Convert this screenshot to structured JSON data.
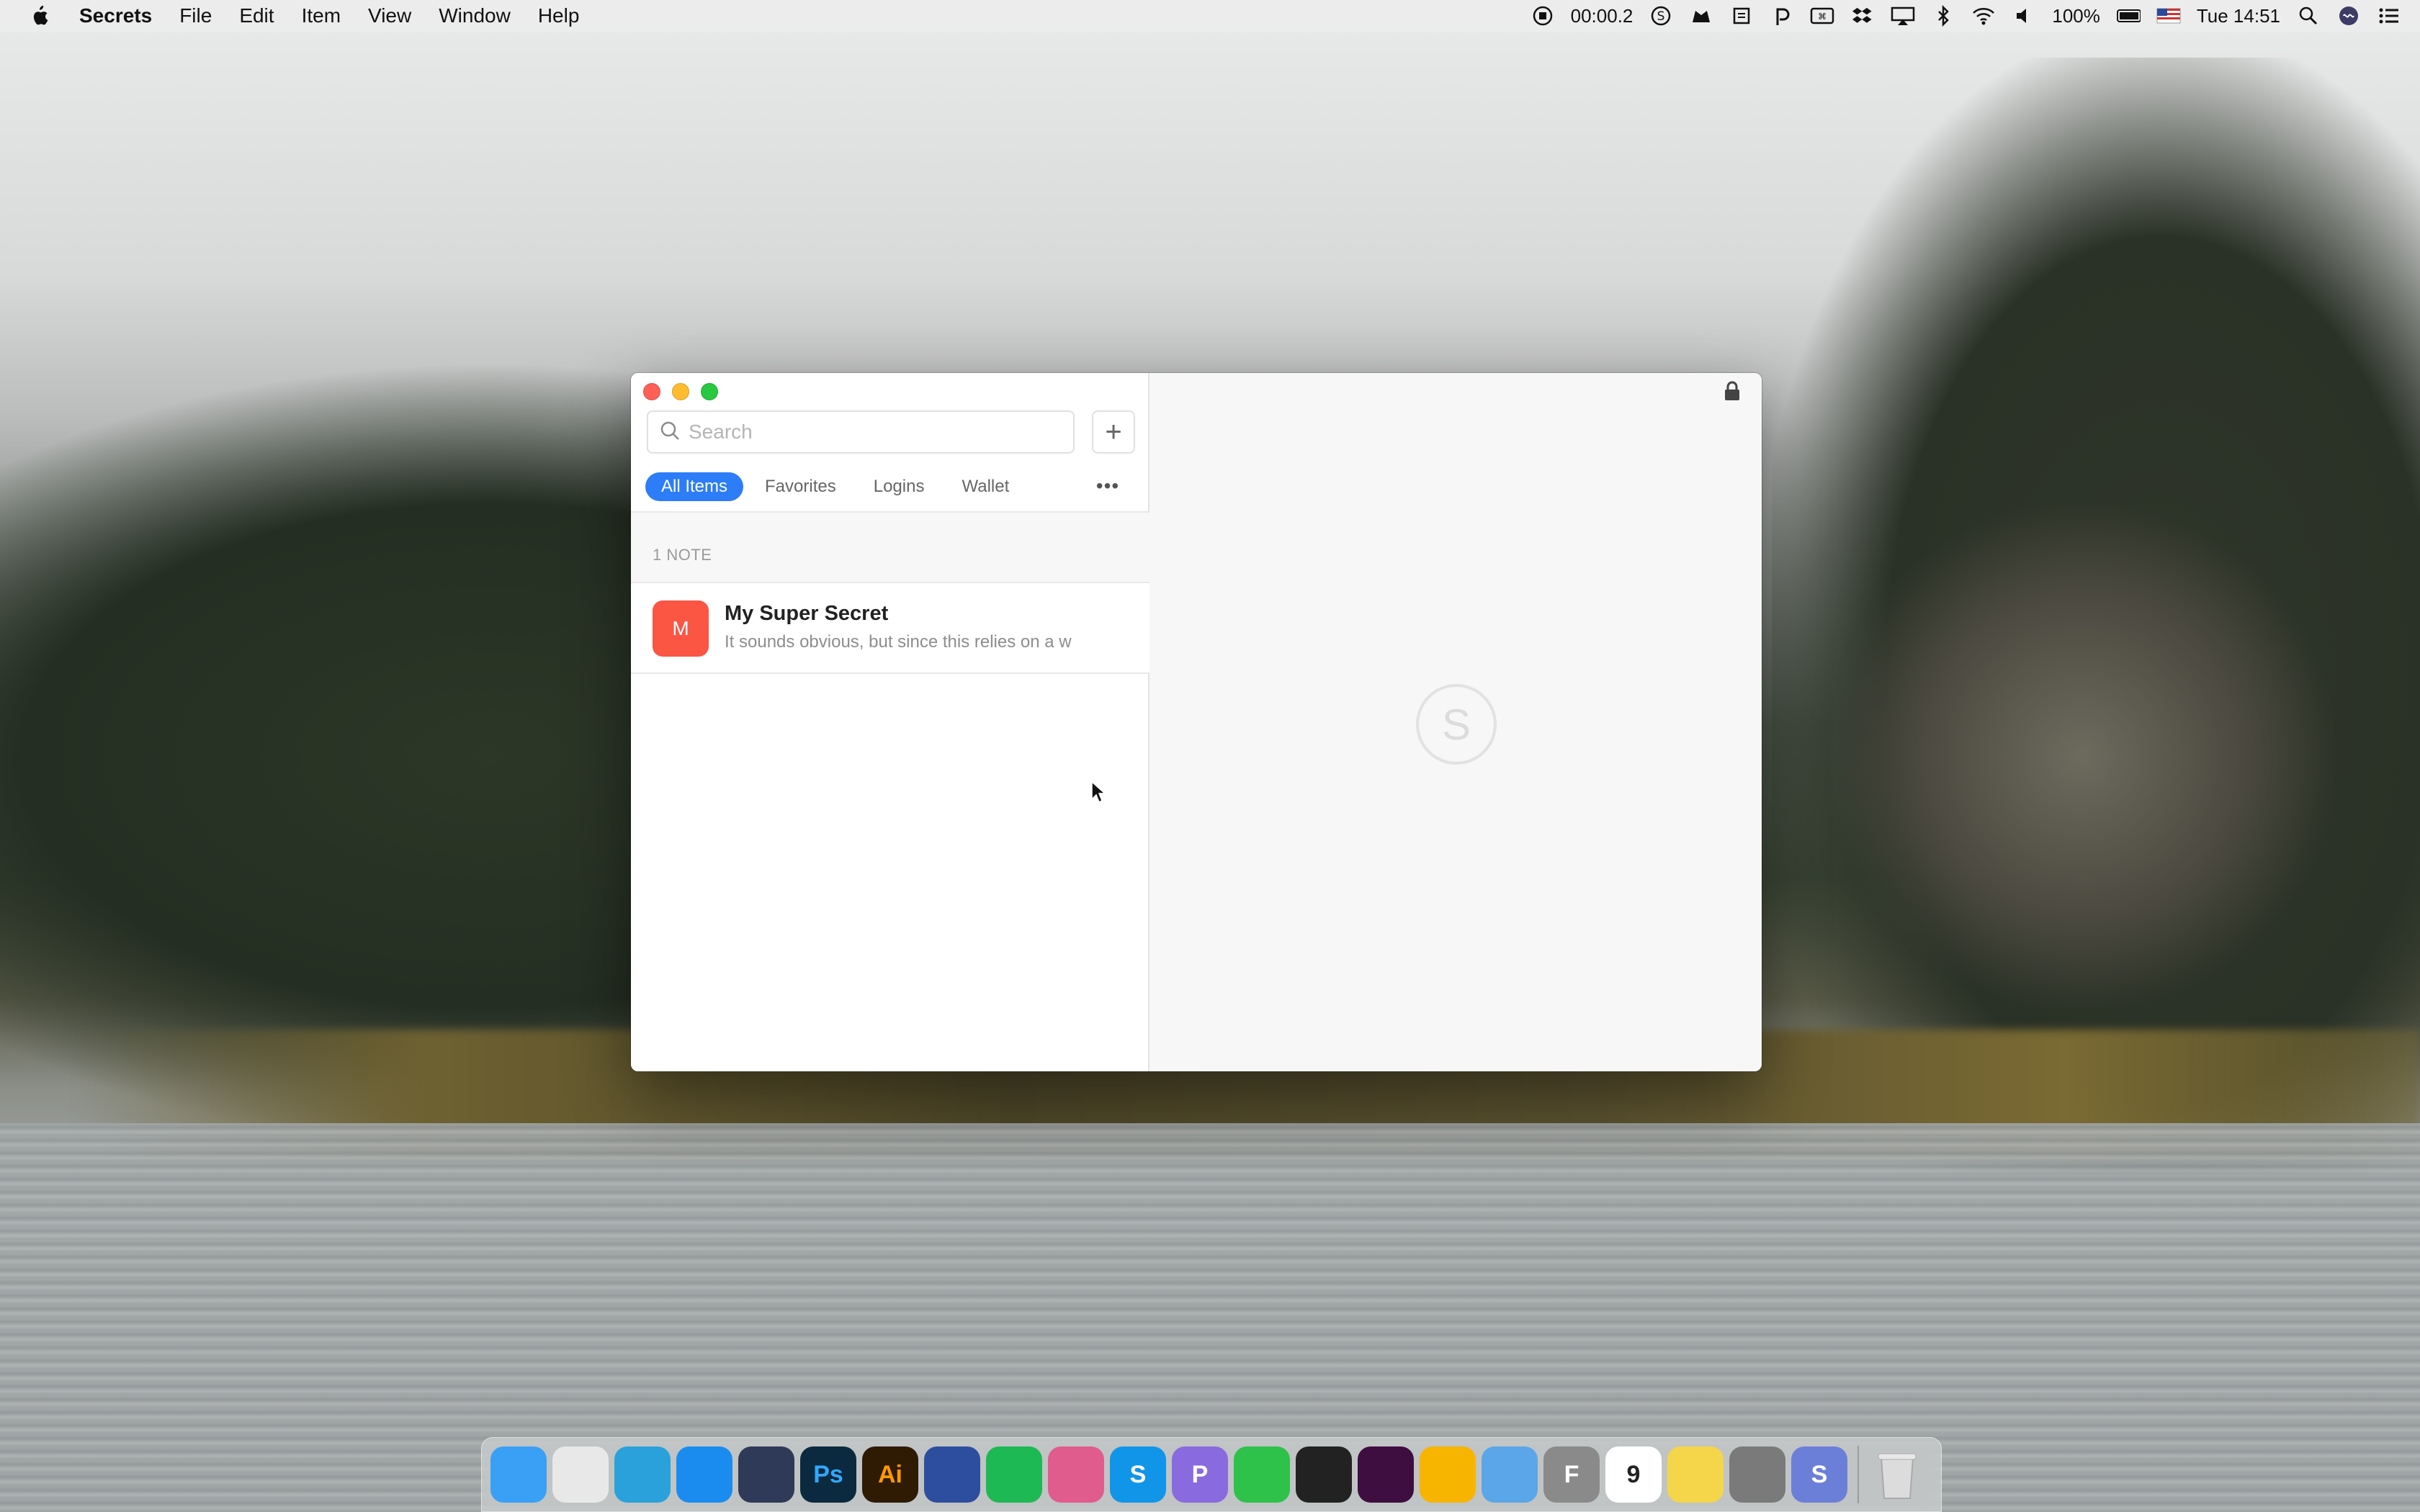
{
  "menubar": {
    "app_name": "Secrets",
    "items": [
      "File",
      "Edit",
      "Item",
      "View",
      "Window",
      "Help"
    ],
    "timer": "00:00.2",
    "battery": "100%",
    "clock": "Tue 14:51"
  },
  "window": {
    "search": {
      "placeholder": "Search",
      "value": ""
    },
    "add_label": "+",
    "tabs": [
      "All Items",
      "Favorites",
      "Logins",
      "Wallet"
    ],
    "more_label": "•••",
    "list_header": "1 NOTE",
    "notes": [
      {
        "avatar": "M",
        "title": "My Super Secret",
        "preview": "It sounds obvious, but since this relies on a w",
        "color": "#fb5544"
      }
    ],
    "placeholder_logo": "S",
    "accent": "#2c7df7"
  },
  "dock": {
    "apps": [
      {
        "name": "finder-icon",
        "label": "",
        "color": "#3aa0f5"
      },
      {
        "name": "chrome-icon",
        "label": "",
        "color": "#e8e8e8"
      },
      {
        "name": "telegram-icon",
        "label": "",
        "color": "#2aa1da"
      },
      {
        "name": "app-store-icon",
        "label": "",
        "color": "#1a8cf0"
      },
      {
        "name": "cinema4d-icon",
        "label": "",
        "color": "#2f3a58"
      },
      {
        "name": "photoshop-icon",
        "label": "Ps",
        "color": "#0b2a3f"
      },
      {
        "name": "illustrator-icon",
        "label": "Ai",
        "color": "#2f1b04"
      },
      {
        "name": "dropbox-icon",
        "label": "",
        "color": "#2d4e9f"
      },
      {
        "name": "spotify-icon",
        "label": "",
        "color": "#1db954"
      },
      {
        "name": "cleanmymac-icon",
        "label": "",
        "color": "#e05c8d"
      },
      {
        "name": "skype-icon",
        "label": "S",
        "color": "#1195e8"
      },
      {
        "name": "pockity-icon",
        "label": "P",
        "color": "#8a6adf"
      },
      {
        "name": "facetime-icon",
        "label": "",
        "color": "#2ec24a"
      },
      {
        "name": "figma-icon",
        "label": "",
        "color": "#222222"
      },
      {
        "name": "slack-icon",
        "label": "",
        "color": "#3f0e40"
      },
      {
        "name": "sketch-icon",
        "label": "",
        "color": "#f7b500"
      },
      {
        "name": "preview-icon",
        "label": "",
        "color": "#5aa6e8"
      },
      {
        "name": "font-book-icon",
        "label": "F",
        "color": "#8a8a8a"
      },
      {
        "name": "calendar-icon",
        "label": "9",
        "color": "#ffffff"
      },
      {
        "name": "notes-icon",
        "label": "",
        "color": "#f5d54a"
      },
      {
        "name": "system-preferences-icon",
        "label": "",
        "color": "#7a7a7a"
      },
      {
        "name": "secrets-icon",
        "label": "S",
        "color": "#6c7fd8"
      }
    ],
    "trash_label": ""
  }
}
